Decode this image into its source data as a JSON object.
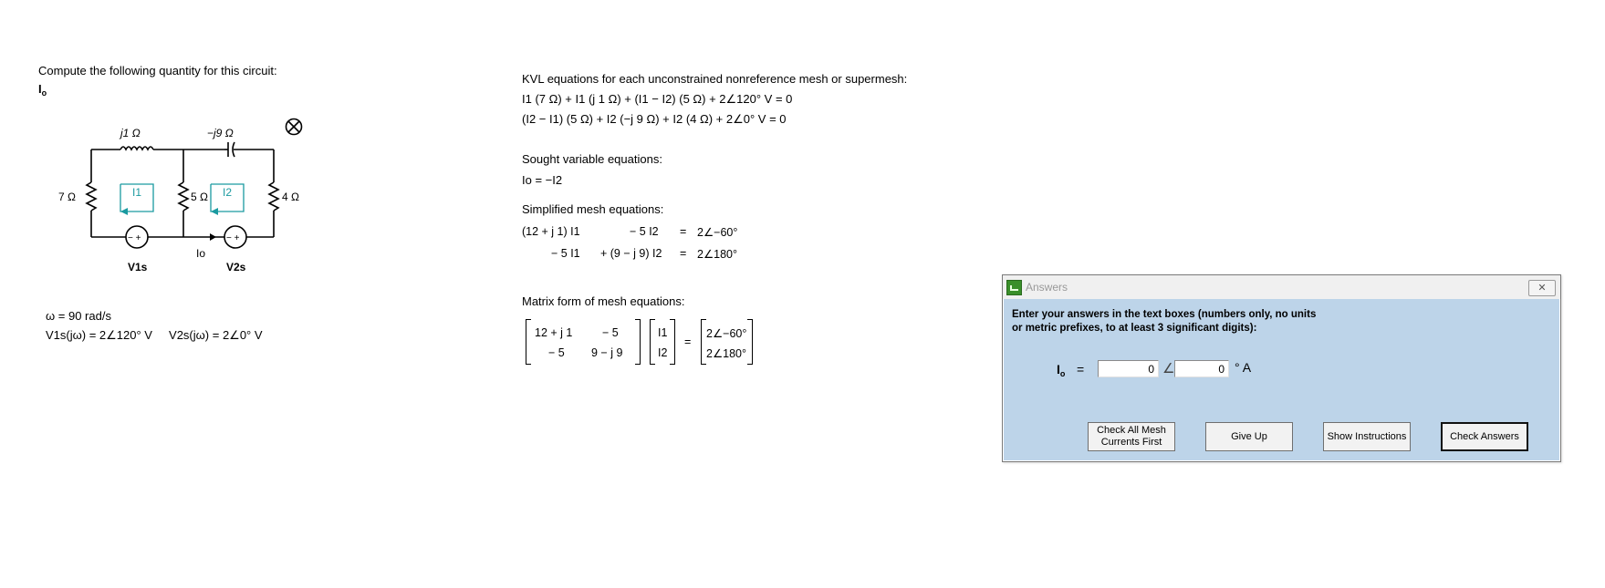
{
  "problem": {
    "prompt": "Compute the following quantity for this circuit:",
    "sought_symbol": "Io",
    "omega_text": "ω = 90 rad/s",
    "source_v1": "V1s(jω) = 2∠120° V",
    "source_v2": "V2s(jω) = 2∠0° V"
  },
  "circuit": {
    "L_label": "j1 Ω",
    "C_label": "−j9 Ω",
    "R1_label": "7 Ω",
    "R2_label": "5 Ω",
    "R3_label": "4 Ω",
    "mesh1_label": "I1",
    "mesh2_label": "I2",
    "io_label": "Io",
    "vs1_label": "V1s",
    "vs2_label": "V2s",
    "source_polarity": "− +",
    "close_icon": "circle-x-icon"
  },
  "kvl": {
    "heading": "KVL equations for each unconstrained nonreference mesh or supermesh:",
    "eq1": "I1 (7 Ω) + I1 (j 1 Ω) + (I1 − I2) (5 Ω) + 2∠120° V = 0",
    "eq2": "(I2 − I1) (5 Ω) + I2 (−j 9 Ω) + I2 (4 Ω) + 2∠0° V = 0"
  },
  "sought": {
    "heading": "Sought variable equations:",
    "eq": "Io = −I2"
  },
  "simplified": {
    "heading": "Simplified mesh equations:",
    "row1": {
      "a": "(12 + j 1) I1",
      "b": "− 5 I2",
      "eq": "=",
      "rhs": "2∠−60°"
    },
    "row2": {
      "a": "− 5 I1",
      "b": "+ (9 − j 9) I2",
      "eq": "=",
      "rhs": "2∠180°"
    }
  },
  "matrix": {
    "heading": "Matrix form of mesh equations:",
    "a11": "12 + j 1",
    "a12": "− 5",
    "a21": "− 5",
    "a22": "9 − j 9",
    "x1": "I1",
    "x2": "I2",
    "eq": "=",
    "b1": "2∠−60°",
    "b2": "2∠180°"
  },
  "answers": {
    "title": "Answers",
    "close_glyph": "✕",
    "instructions": "Enter your answers in the text boxes (numbers only, no units or metric prefixes, to at least 3 significant digits):",
    "label": "Io",
    "eq_sign": "=",
    "magnitude_value": "0",
    "angle_symbol": "∠",
    "angle_value": "0",
    "unit": "° A",
    "buttons": {
      "check_mesh": "Check All Mesh Currents First",
      "give_up": "Give Up",
      "show_instructions": "Show Instructions",
      "check_answers": "Check Answers"
    }
  }
}
